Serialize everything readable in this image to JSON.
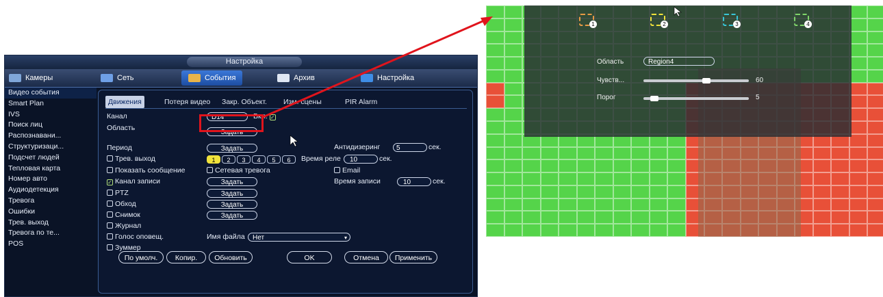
{
  "dvr": {
    "title": "Настройка",
    "tabs": [
      {
        "label": "Камеры"
      },
      {
        "label": "Сеть"
      },
      {
        "label": "События"
      },
      {
        "label": "Архив"
      },
      {
        "label": "Настройка"
      }
    ],
    "sidebar": [
      "Видео события",
      "Smart Plan",
      "IVS",
      "Поиск лиц",
      "Распознавани...",
      "Структуризаци...",
      "Подсчет людей",
      "Тепловая карта",
      "Номер авто",
      "Аудиодетекция",
      "Тревога",
      "Ошибки",
      "Трев. выход",
      "Тревога по те...",
      "POS"
    ],
    "subtabs": [
      "Движения",
      "Потеря видео",
      "Закр. Объект.",
      "Изм. сцены",
      "PIR Alarm"
    ],
    "form": {
      "channel_label": "Канал",
      "channel_value": "D14",
      "enable_label": "Вкл.",
      "area_label": "Область",
      "set_label": "Задать",
      "period_label": "Период",
      "antidither_label": "Антидизеринг",
      "antidither_value": "5",
      "sec": "сек.",
      "alarm_out_label": "Трев. выход",
      "alarm_out_nums": [
        "1",
        "2",
        "3",
        "4",
        "5",
        "6"
      ],
      "relay_time_label": "Время реле",
      "relay_time_value": "10",
      "show_msg_label": "Показать сообщение",
      "net_alarm_label": "Сетевая тревога",
      "email_label": "Email",
      "rec_channel_label": "Канал записи",
      "rec_time_label": "Время записи",
      "rec_time_value": "10",
      "ptz_label": "PTZ",
      "tour_label": "Обход",
      "snapshot_label": "Снимок",
      "log_label": "Журнал",
      "voice_label": "Голос оповещ.",
      "file_name_label": "Имя файла",
      "file_name_value": "Нет",
      "buzzer_label": "Зуммер"
    },
    "buttons": [
      "По умолч.",
      "Копир.",
      "Обновить",
      "OK",
      "Отмена",
      "Применить"
    ]
  },
  "preview": {
    "regions": [
      "1",
      "2",
      "3",
      "4"
    ],
    "area_label": "Область",
    "area_value": "Region4",
    "sens_label": "Чувств...",
    "sens_value": "60",
    "threshold_label": "Порог",
    "threshold_value": "5"
  },
  "colors": {
    "accent": "#3b78d8",
    "highlight": "#e0141c",
    "grid_green": "#55d44a",
    "grid_red": "#e85038"
  }
}
